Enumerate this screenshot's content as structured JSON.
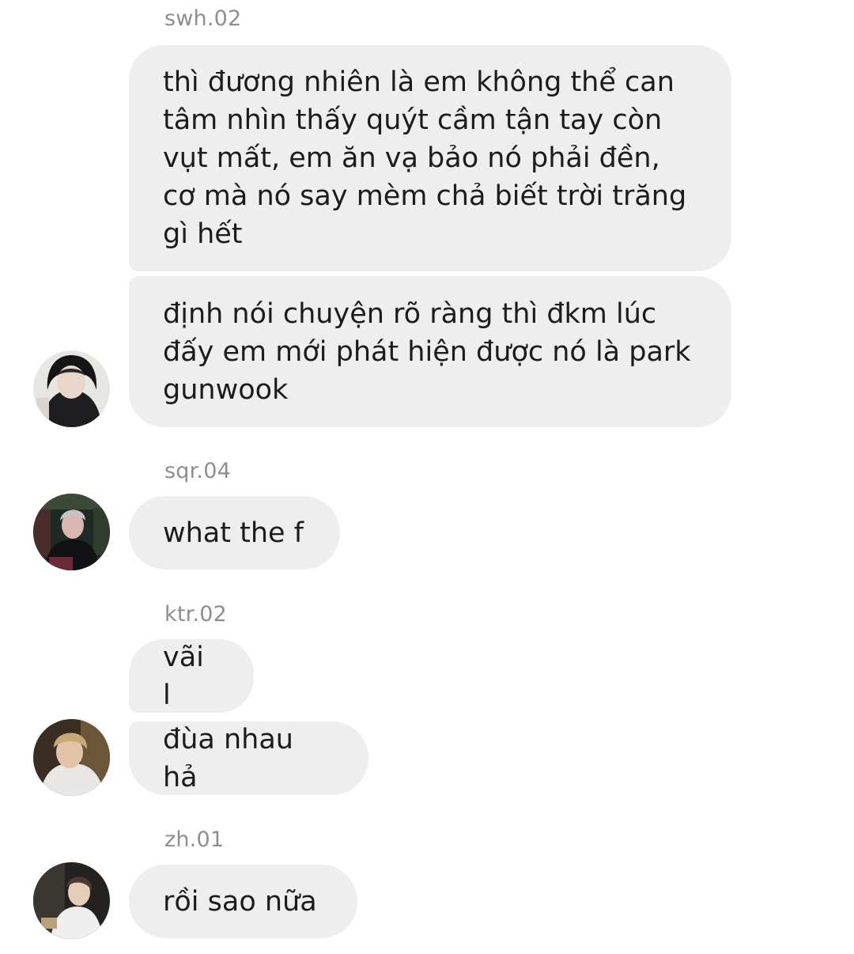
{
  "groups": [
    {
      "sender": "swh.02",
      "messages": [
        "thì đương nhiên là em không thể can tâm nhìn thấy quýt cầm tận tay còn vụt mất, em ăn vạ bảo nó phải đền, cơ mà nó say mèm chả biết trời trăng gì hết",
        "định nói chuyện rõ ràng thì đkm lúc đấy em mới phát hiện được nó là park gunwook"
      ]
    },
    {
      "sender": "sqr.04",
      "messages": [
        "what the f"
      ]
    },
    {
      "sender": "ktr.02",
      "messages": [
        "vãi l",
        "đùa nhau hả"
      ]
    },
    {
      "sender": "zh.01",
      "messages": [
        "rồi sao nữa"
      ]
    }
  ],
  "colors": {
    "bubble": "#eeeeee",
    "text": "#1c1c1c",
    "sender": "#8e8e8e",
    "background": "#ffffff"
  }
}
